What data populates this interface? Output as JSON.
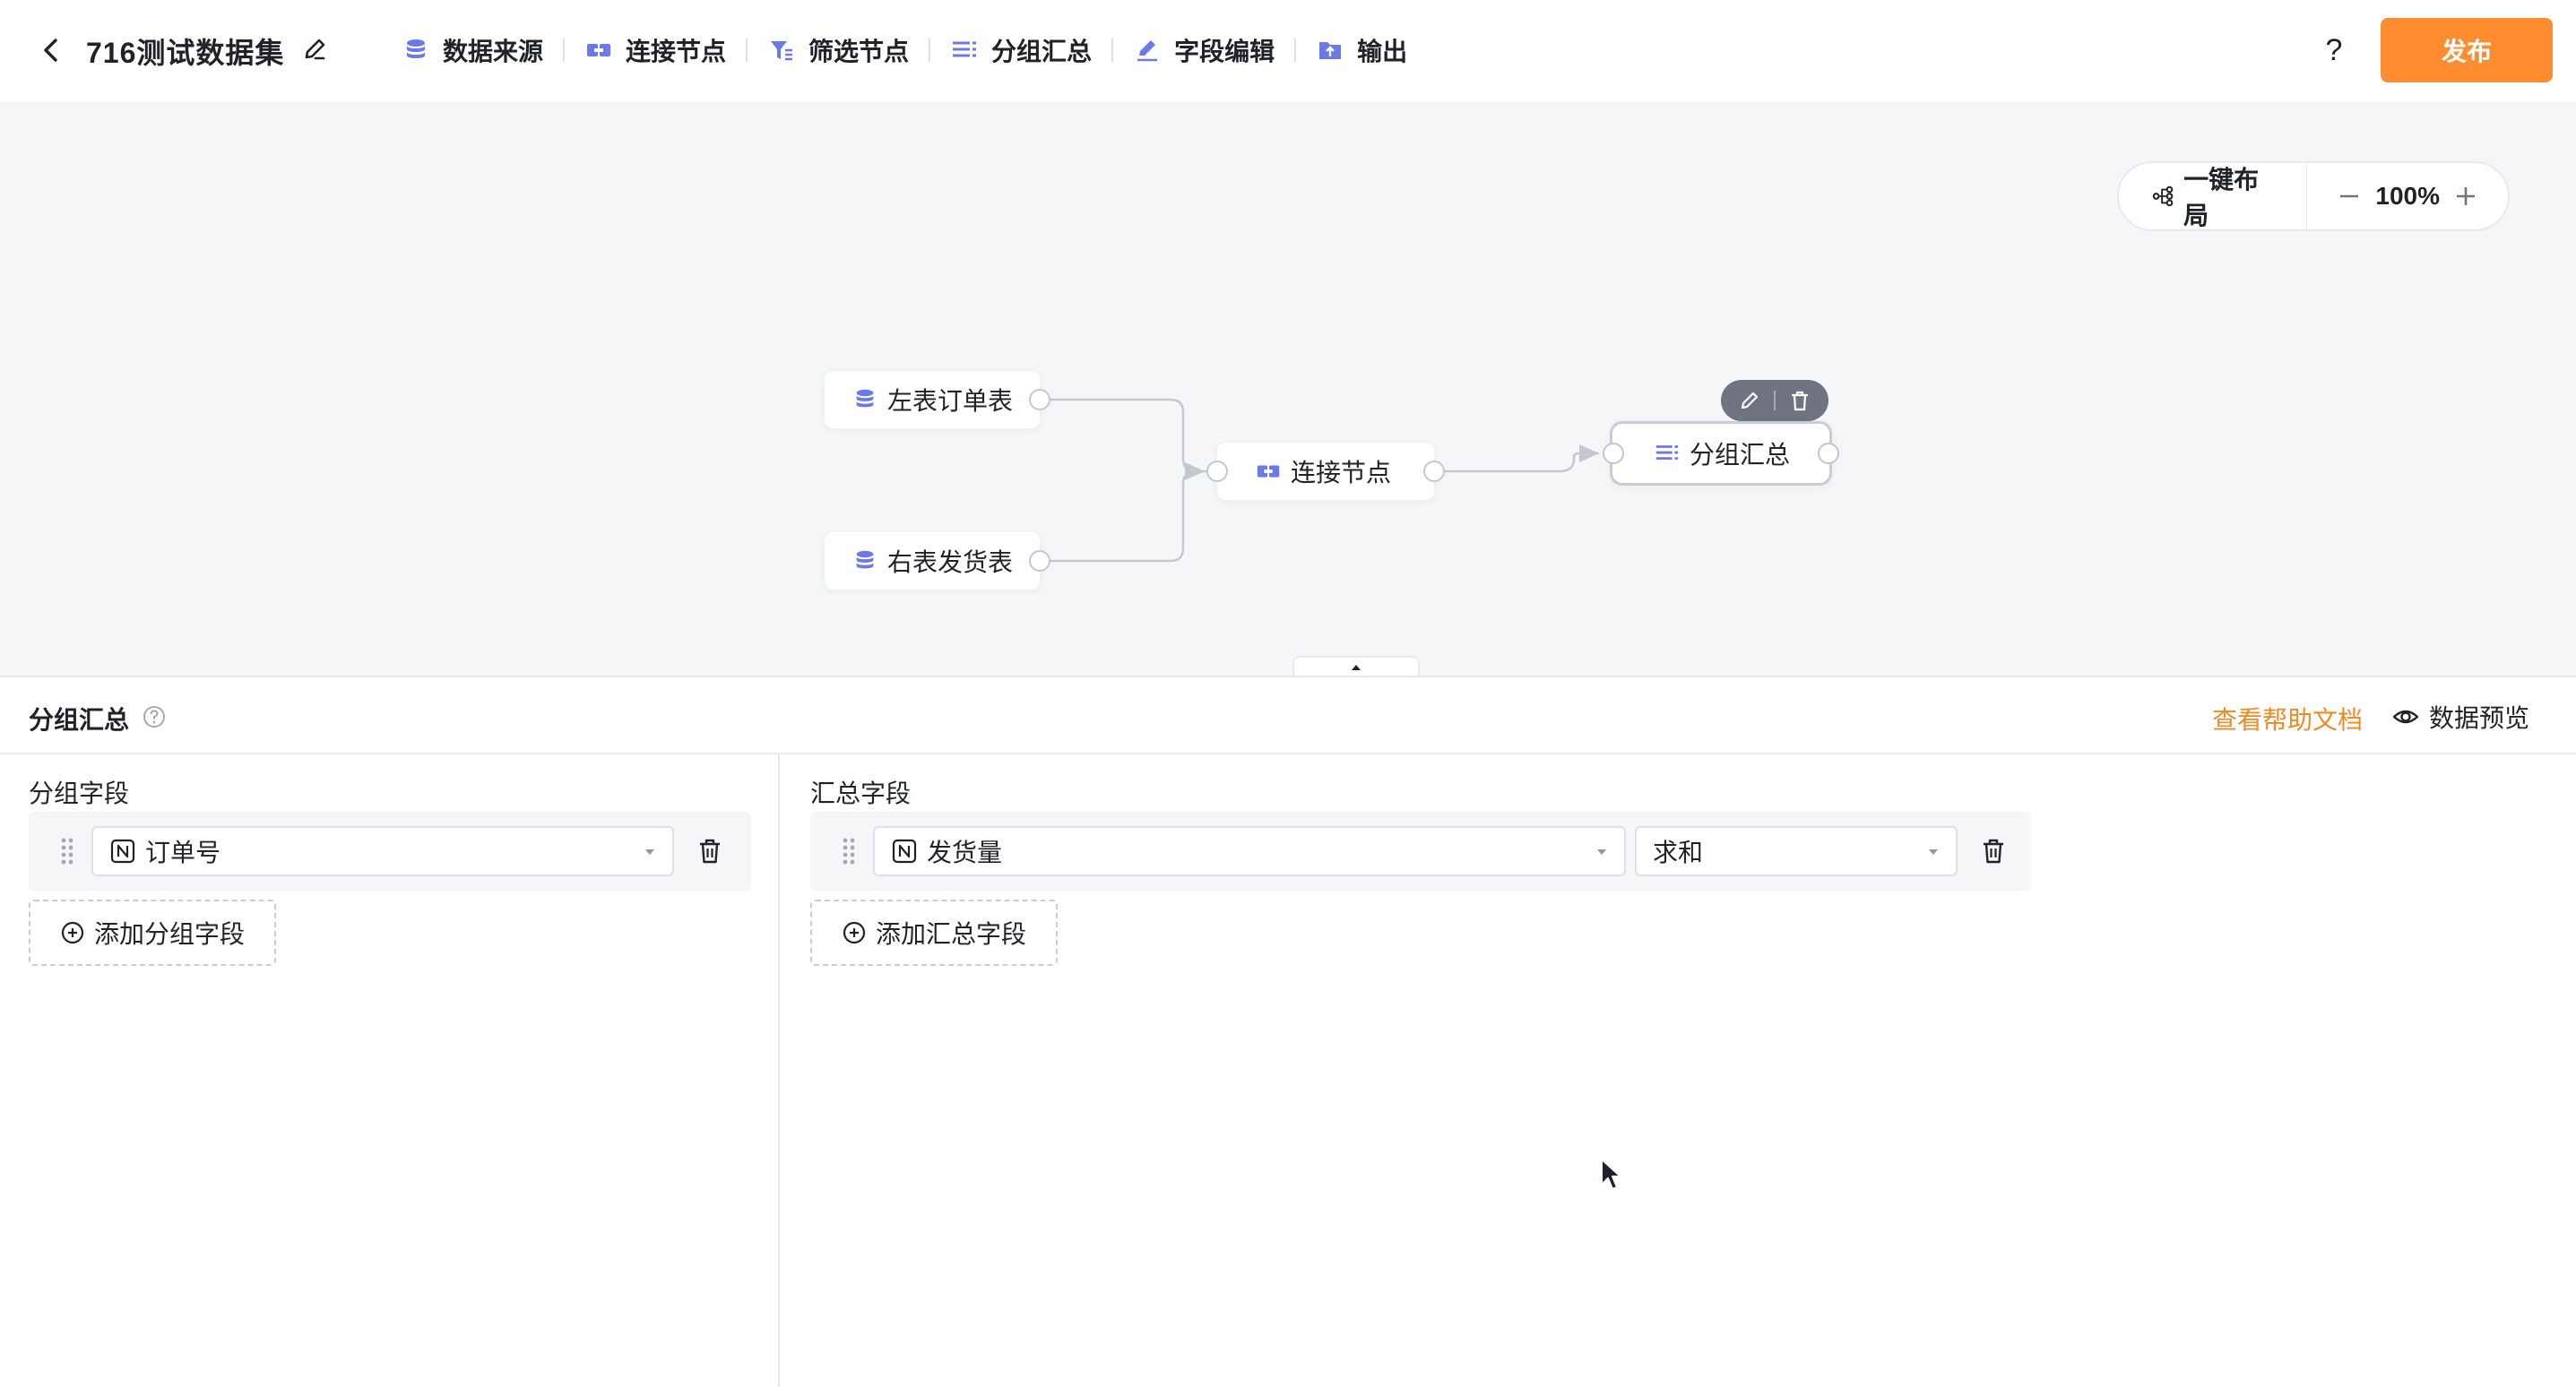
{
  "header": {
    "title": "716测试数据集",
    "toolbar": [
      {
        "label": "数据来源",
        "icon": "database-icon"
      },
      {
        "label": "连接节点",
        "icon": "join-icon"
      },
      {
        "label": "筛选节点",
        "icon": "filter-icon"
      },
      {
        "label": "分组汇总",
        "icon": "group-icon"
      },
      {
        "label": "字段编辑",
        "icon": "pen-icon"
      },
      {
        "label": "输出",
        "icon": "output-icon"
      }
    ],
    "help": "?",
    "publish_label": "发布"
  },
  "canvas": {
    "auto_layout_label": "一键布局",
    "zoom": "100%",
    "nodes": {
      "left_table": "左表订单表",
      "right_table": "右表发货表",
      "join": "连接节点",
      "group": "分组汇总"
    }
  },
  "panel": {
    "title": "分组汇总",
    "help_doc_label": "查看帮助文档",
    "preview_label": "数据预览",
    "group_section": {
      "label": "分组字段",
      "field": "订单号",
      "add_label": "添加分组字段"
    },
    "agg_section": {
      "label": "汇总字段",
      "field": "发货量",
      "method": "求和",
      "add_label": "添加汇总字段"
    }
  },
  "colors": {
    "accent": "#ff8c2f",
    "link": "#f08a24",
    "node_icon": "#6b7ae8",
    "canvas_bg": "#f5f6f8"
  }
}
